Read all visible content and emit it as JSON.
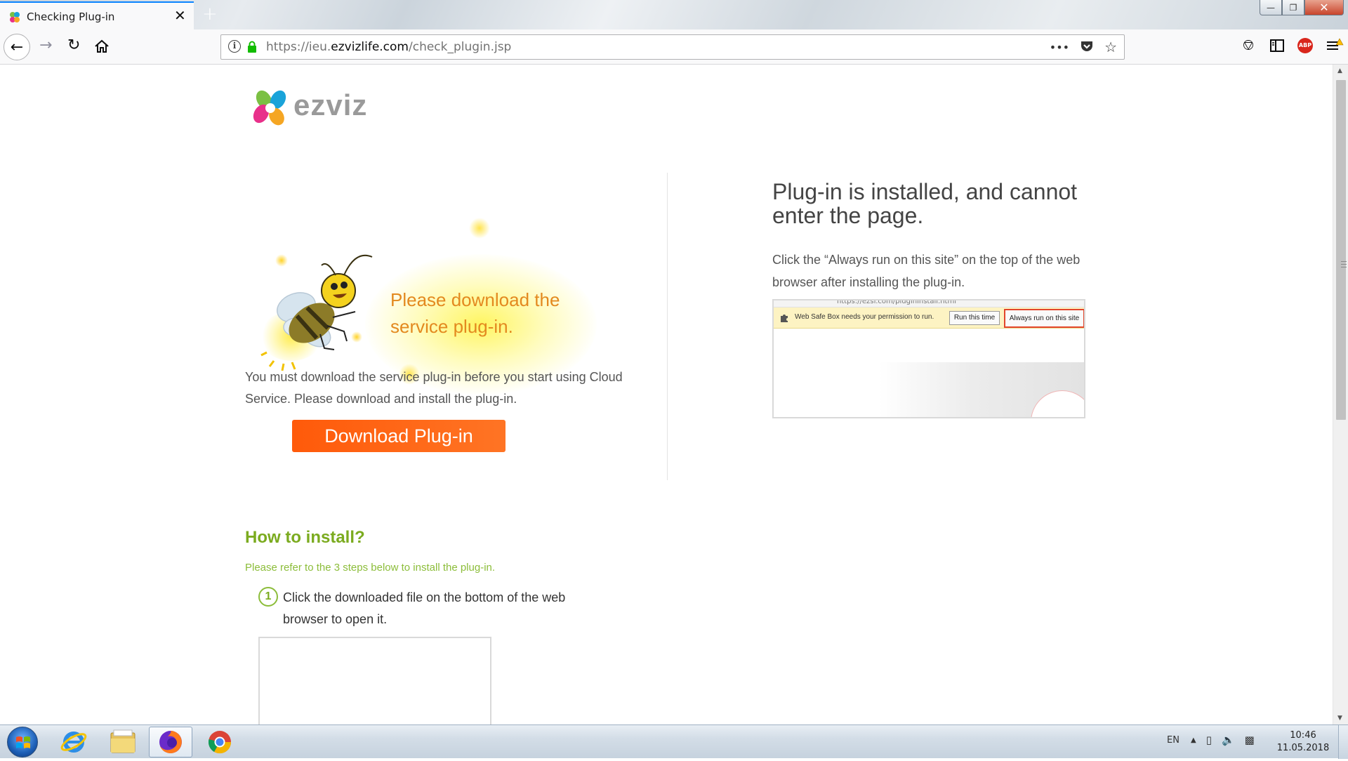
{
  "browser": {
    "tab_title": "Checking Plug-in",
    "tab_close": "✕",
    "new_tab": "+",
    "url_prefix": "https://ieu.",
    "url_domain": "ezvizlife.com",
    "url_path": "/check_plugin.jsp",
    "url_info": "i",
    "url_more": "•••",
    "win_min": "—",
    "win_restore": "❐",
    "win_close": "✕",
    "abp_label": "ABP"
  },
  "page": {
    "logo_text": "ezviz",
    "bee_message_line1": "Please download the",
    "bee_message_line2": "service plug-in.",
    "must_text": "You must download the service plug-in before you start using Cloud Service. Please download and install the plug-in.",
    "download_button": "Download Plug-in",
    "right_title": "Plug-in is installed, and cannot enter the page.",
    "right_desc": "Click the “Always run on this site” on the top of the web browser after installing the plug-in.",
    "shot_address": "https://ezsf.com/plugininstall.html",
    "shot_bar_text": "Web Safe Box needs your permission to run.",
    "shot_btn1": "Run this time",
    "shot_btn2": "Always run on this site",
    "howto_title": "How to install?",
    "howto_sub": "Please refer to the 3 steps below to install the plug-in.",
    "step1_num": "1",
    "step1_text": "Click the downloaded file on the bottom of the web browser to open it."
  },
  "taskbar": {
    "lang": "EN",
    "time": "10:46",
    "date": "11.05.2018"
  },
  "colors": {
    "accent_orange": "#ff5a0a",
    "bee_text": "#e3891f",
    "howto_green": "#7bab1f",
    "firefox_blue": "#0a84ff"
  }
}
